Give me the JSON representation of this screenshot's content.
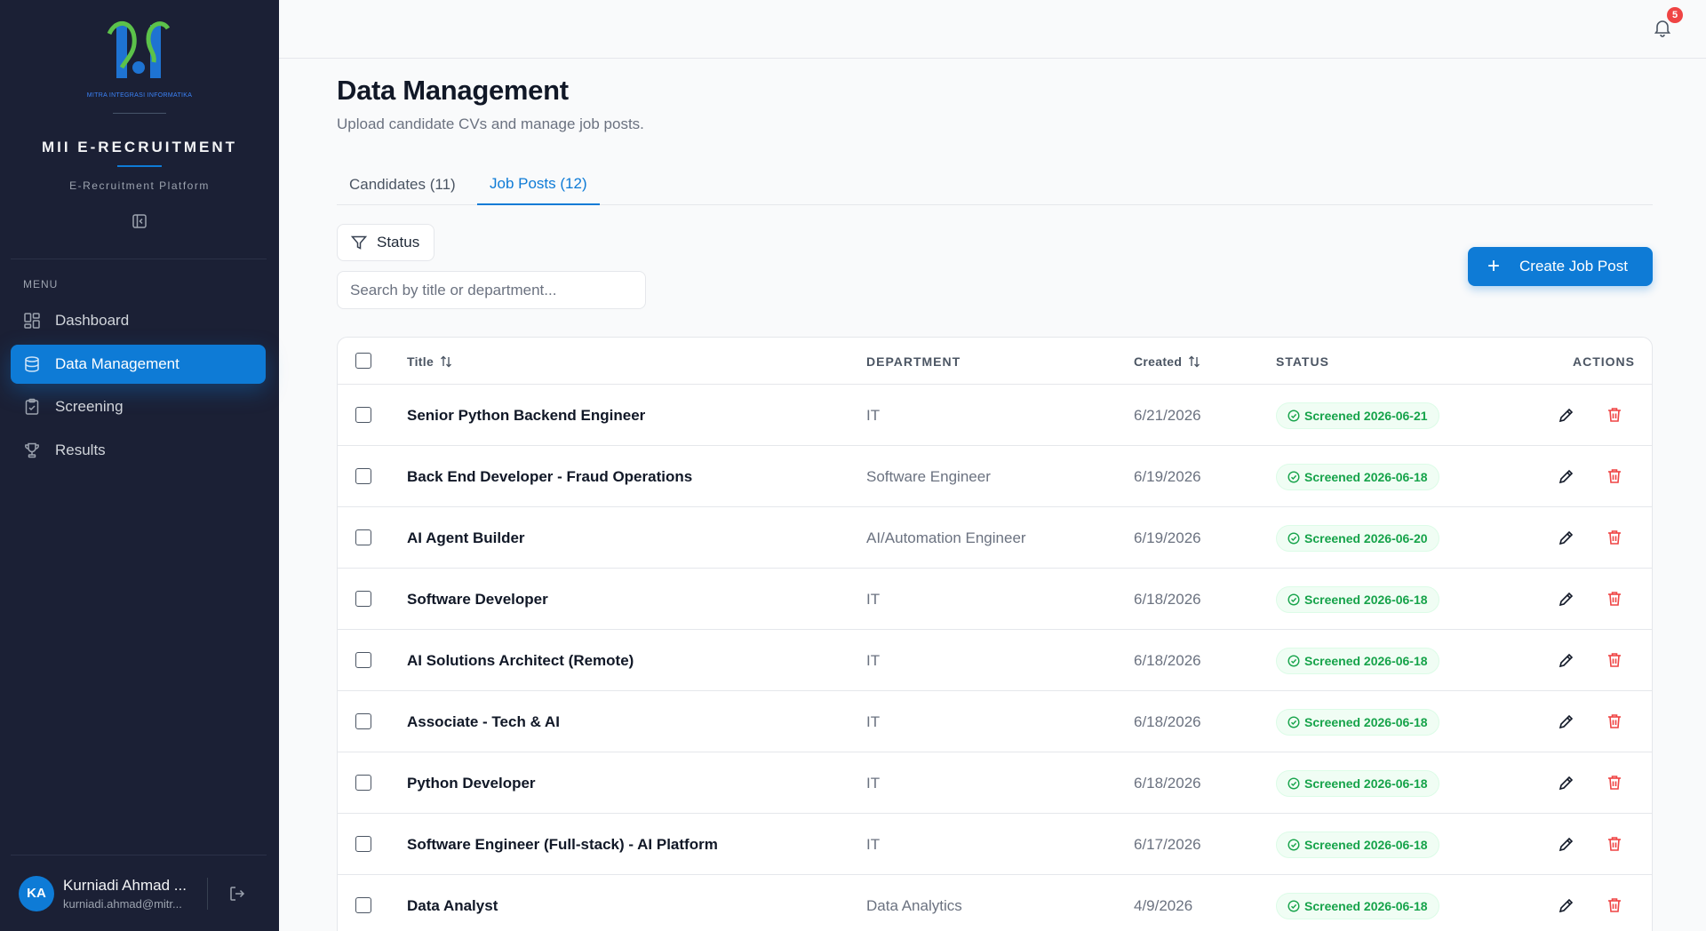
{
  "sidebar": {
    "logo_text": "MITRA INTEGRASI INFORMATIKA",
    "app_title": "MII E-RECRUITMENT",
    "app_subtitle": "E-Recruitment Platform",
    "menu_label": "MENU",
    "items": [
      {
        "label": "Dashboard",
        "icon": "dashboard-icon",
        "active": false
      },
      {
        "label": "Data Management",
        "icon": "database-icon",
        "active": true
      },
      {
        "label": "Screening",
        "icon": "clipboard-check-icon",
        "active": false
      },
      {
        "label": "Results",
        "icon": "trophy-icon",
        "active": false
      }
    ],
    "user": {
      "initials": "KA",
      "name": "Kurniadi Ahmad ...",
      "email": "kurniadi.ahmad@mitr..."
    }
  },
  "header": {
    "notification_count": "5"
  },
  "page": {
    "title": "Data Management",
    "subtitle": "Upload candidate CVs and manage job posts.",
    "tabs": [
      {
        "label": "Candidates (11)",
        "active": false
      },
      {
        "label": "Job Posts (12)",
        "active": true
      }
    ],
    "filter_label": "Status",
    "search_placeholder": "Search by title or department...",
    "create_button": "Create Job Post"
  },
  "table": {
    "columns": {
      "title": "Title",
      "department": "DEPARTMENT",
      "created": "Created",
      "status": "STATUS",
      "actions": "ACTIONS"
    },
    "rows": [
      {
        "title": "Senior Python Backend Engineer",
        "department": "IT",
        "created": "6/21/2026",
        "status": "Screened 2026-06-21"
      },
      {
        "title": "Back End Developer - Fraud Operations",
        "department": "Software Engineer",
        "created": "6/19/2026",
        "status": "Screened 2026-06-18"
      },
      {
        "title": "AI Agent Builder",
        "department": "AI/Automation Engineer",
        "created": "6/19/2026",
        "status": "Screened 2026-06-20"
      },
      {
        "title": "Software Developer",
        "department": "IT",
        "created": "6/18/2026",
        "status": "Screened 2026-06-18"
      },
      {
        "title": "AI Solutions Architect (Remote)",
        "department": "IT",
        "created": "6/18/2026",
        "status": "Screened 2026-06-18"
      },
      {
        "title": "Associate - Tech & AI",
        "department": "IT",
        "created": "6/18/2026",
        "status": "Screened 2026-06-18"
      },
      {
        "title": "Python Developer",
        "department": "IT",
        "created": "6/18/2026",
        "status": "Screened 2026-06-18"
      },
      {
        "title": "Software Engineer (Full-stack) - AI Platform",
        "department": "IT",
        "created": "6/17/2026",
        "status": "Screened 2026-06-18"
      },
      {
        "title": "Data Analyst",
        "department": "Data Analytics",
        "created": "4/9/2026",
        "status": "Screened 2026-06-18"
      }
    ]
  },
  "colors": {
    "sidebar_bg": "#1b2035",
    "accent": "#0e7bd6",
    "success": "#16a34a",
    "danger": "#ef4444"
  }
}
